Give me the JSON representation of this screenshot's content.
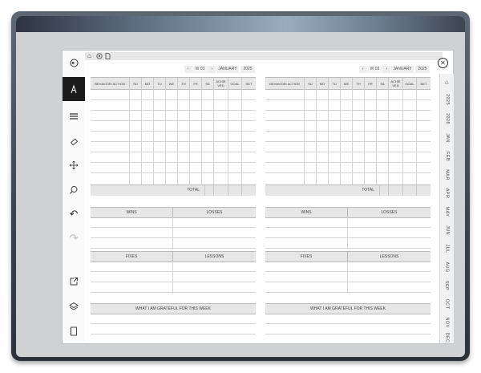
{
  "header": {
    "week_label": "W 03",
    "month_label": "JANUARY",
    "year_label": "2025",
    "prev_arrow": "‹",
    "next_arrow": "›"
  },
  "tracker": {
    "columns": [
      "BEHAVIOR/ ACTION",
      "SU",
      "MO",
      "TU",
      "WE",
      "TH",
      "FR",
      "SA",
      "ACHIE VED",
      "GOAL",
      "NET"
    ],
    "total_label": "TOTAL"
  },
  "sections": {
    "wins": "WINS",
    "losses": "LOSSES",
    "fixes": "FIXES",
    "lessons": "LESSONS",
    "grateful": "WHAT I AM GRATEFUL FOR THIS WEEK"
  },
  "tabs": [
    "2025",
    "2026",
    "JAN",
    "FEB",
    "MAR",
    "APR",
    "MAY",
    "JUN",
    "JUL",
    "AUG",
    "SEP",
    "OCT",
    "NOV",
    "DEC"
  ],
  "icons": {
    "close": "✕",
    "home": "⌂",
    "back": "↶",
    "forward": "↷"
  }
}
